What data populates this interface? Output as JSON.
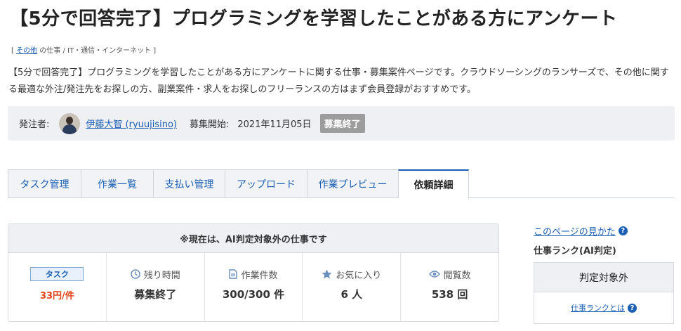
{
  "page": {
    "title": "【5分で回答完了】プログラミングを学習したことがある方にアンケート"
  },
  "breadcrumb": {
    "open": "[",
    "link": "その他",
    "rest": "の仕事 / IT・通信・インターネット",
    "close": "]"
  },
  "description": "【5分で回答完了】プログラミングを学習したことがある方にアンケートに関する仕事・募集案件ページです。クラウドソーシングのランサーズで、その他に関する最適な外注/発注先をお探しの方、副業案件・求人をお探しのフリーランスの方はまず会員登録がおすすめです。",
  "info": {
    "client_label": "発注者:",
    "client_name": "伊藤大智 (ryuujisino)",
    "start_label": "募集開始:",
    "start_date": "2021年11月05日",
    "status_badge": "募集終了"
  },
  "tabs": [
    {
      "label": "タスク管理",
      "active": false
    },
    {
      "label": "作業一覧",
      "active": false
    },
    {
      "label": "支払い管理",
      "active": false
    },
    {
      "label": "アップロード",
      "active": false
    },
    {
      "label": "作業プレビュー",
      "active": false
    },
    {
      "label": "依頼詳細",
      "active": true
    }
  ],
  "stats": {
    "header": "※現在は、AI判定対象外の仕事です",
    "task_tag": "タスク",
    "price": "33円/件",
    "remaining_label": "残り時間",
    "remaining_value": "募集終了",
    "count_label": "作業件数",
    "count_value": "300/300 件",
    "favorite_label": "お気に入り",
    "favorite_value": "6 人",
    "views_label": "閲覧数",
    "views_value": "538 回"
  },
  "sidebar": {
    "help_link": "このページの見かた",
    "rank_title": "仕事ランク(AI判定)",
    "rank_value": "判定対象外",
    "rank_link": "仕事ランクとは"
  },
  "colors": {
    "link": "#1a5fb4",
    "price": "#e0461b",
    "badge_closed": "#9c9c9c",
    "panel_bg": "#eef0f4"
  },
  "icons": {
    "remaining": "clock-icon",
    "count": "document-icon",
    "favorite": "star-icon",
    "views": "eye-icon",
    "help": "question-circle-icon"
  }
}
